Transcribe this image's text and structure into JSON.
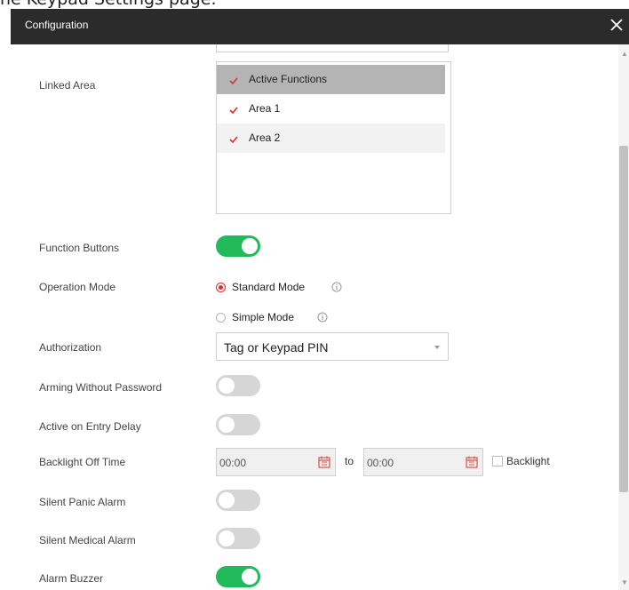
{
  "caption": "he Keypad Settings page.",
  "dialog": {
    "title": "Configuration"
  },
  "linked_area": {
    "label": "Linked Area",
    "items": [
      {
        "label": "Active Functions",
        "checked": true
      },
      {
        "label": "Area 1",
        "checked": true
      },
      {
        "label": "Area 2",
        "checked": true
      }
    ]
  },
  "function_buttons": {
    "label": "Function Buttons",
    "enabled": true
  },
  "operation_mode": {
    "label": "Operation Mode",
    "options": [
      {
        "label": "Standard Mode",
        "selected": true
      },
      {
        "label": "Simple Mode",
        "selected": false
      }
    ]
  },
  "authorization": {
    "label": "Authorization",
    "value": "Tag or Keypad PIN"
  },
  "arming_without_password": {
    "label": "Arming Without Password",
    "enabled": false
  },
  "active_on_entry_delay": {
    "label": "Active on Entry Delay",
    "enabled": false
  },
  "backlight_off_time": {
    "label": "Backlight Off Time",
    "start": "00:00",
    "to_label": "to",
    "end": "00:00",
    "backlight_label": "Backlight",
    "backlight_checked": false
  },
  "silent_panic_alarm": {
    "label": "Silent Panic Alarm",
    "enabled": false
  },
  "silent_medical_alarm": {
    "label": "Silent Medical Alarm",
    "enabled": false
  },
  "alarm_buzzer": {
    "label": "Alarm Buzzer",
    "enabled": true
  },
  "colors": {
    "titlebar": "#2b2b2b",
    "toggle_on": "#21ba5a",
    "toggle_off": "#d6d6d6",
    "check_accent": "#e02b2b",
    "selected_row": "#b4b4b4"
  },
  "icons": {
    "close": "close-icon",
    "check": "checkmark-icon",
    "info": "info-icon",
    "calendar": "calendar-icon",
    "dropdown": "chevron-down-icon"
  }
}
